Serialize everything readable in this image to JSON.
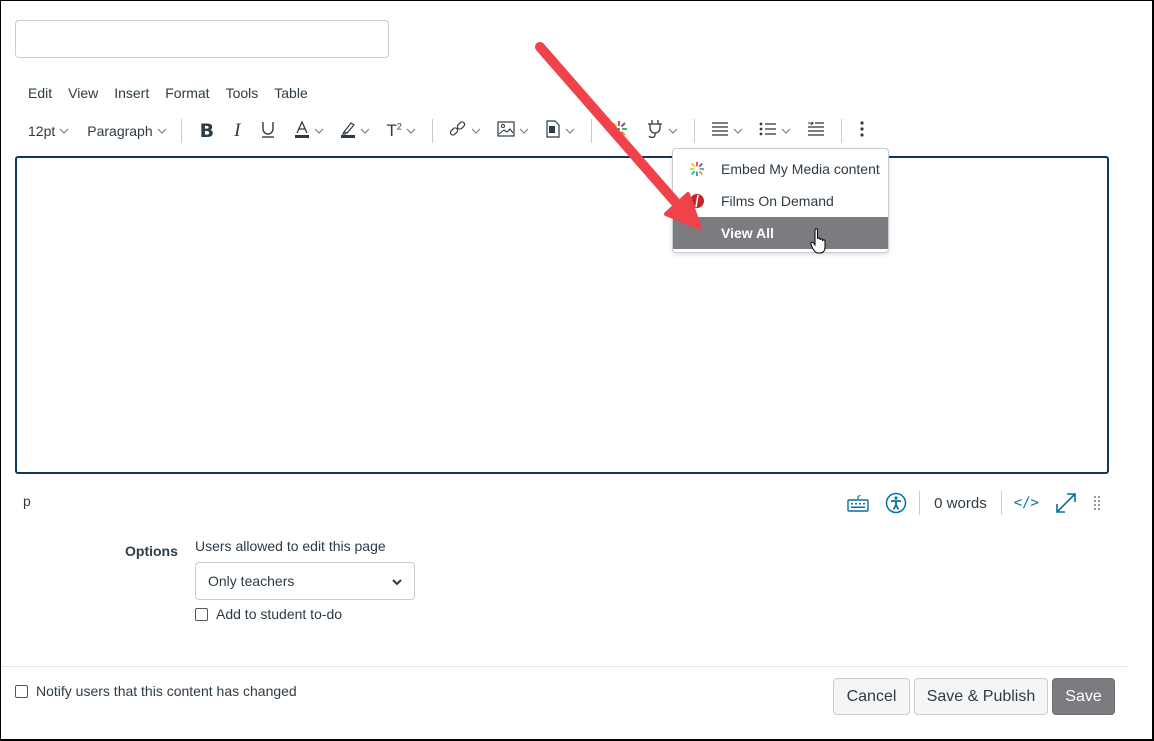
{
  "title_input": {
    "value": "",
    "placeholder": ""
  },
  "menubar": [
    "Edit",
    "View",
    "Insert",
    "Format",
    "Tools",
    "Table"
  ],
  "toolbar": {
    "font_size": "12pt",
    "block_format": "Paragraph",
    "buttons": [
      {
        "name": "bold",
        "icon": "bold-icon"
      },
      {
        "name": "italic",
        "icon": "italic-icon"
      },
      {
        "name": "underline",
        "icon": "underline-icon"
      },
      {
        "name": "text-color",
        "icon": "text-color-icon"
      },
      {
        "name": "highlight-color",
        "icon": "highlight-icon"
      },
      {
        "name": "superscript",
        "icon": "superscript-icon"
      },
      {
        "name": "link",
        "icon": "link-icon"
      },
      {
        "name": "image",
        "icon": "image-icon"
      },
      {
        "name": "document",
        "icon": "document-icon"
      },
      {
        "name": "my-media",
        "icon": "kaltura-icon"
      },
      {
        "name": "apps",
        "icon": "plug-icon"
      },
      {
        "name": "align",
        "icon": "align-icon"
      },
      {
        "name": "list",
        "icon": "list-icon"
      },
      {
        "name": "indent",
        "icon": "indent-icon"
      },
      {
        "name": "more",
        "icon": "more-vertical-icon"
      }
    ]
  },
  "apps_dropdown": {
    "items": [
      {
        "label": "Embed My Media content",
        "icon": "kaltura-icon",
        "active": false
      },
      {
        "label": "Films On Demand",
        "icon": "films-on-demand-icon",
        "active": false
      },
      {
        "label": "View All",
        "icon": "",
        "active": true
      }
    ]
  },
  "statusbar": {
    "path": "p",
    "word_count": "0 words",
    "icons": [
      "keyboard-icon",
      "accessibility-icon",
      "html-editor-icon",
      "fullscreen-icon",
      "resize-handle-icon"
    ]
  },
  "options": {
    "label": "Options",
    "edit_label": "Users allowed to edit this page",
    "edit_selected": "Only teachers",
    "todo_label": "Add to student to-do",
    "todo_checked": false
  },
  "footer": {
    "notify_label": "Notify users that this content has changed",
    "notify_checked": false,
    "cancel_label": "Cancel",
    "save_publish_label": "Save & Publish",
    "save_label": "Save"
  },
  "colors": {
    "editor_border": "#0e3760",
    "primary_button": "#7c7c80",
    "annotation_arrow": "#f0424a",
    "teal_icon": "#0770a3"
  }
}
